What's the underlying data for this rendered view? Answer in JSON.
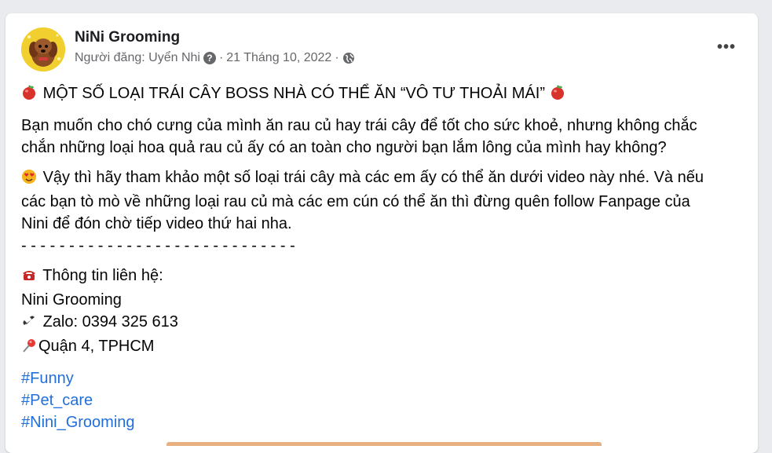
{
  "post": {
    "page_name": "NiNi Grooming",
    "author": "Người đăng: Uyển Nhi",
    "date": "21 Tháng 10, 2022",
    "separator": "·",
    "more_label": "•••",
    "title": "MỘT SỐ LOẠI TRÁI CÂY BOSS NHÀ CÓ THỂ ĂN “VÔ TƯ THOẢI MÁI”",
    "para1_line1": "Bạn muốn cho chó cưng của mình ăn rau củ hay trái cây để tốt cho sức khoẻ, nhưng không chắc",
    "para1_line2": "chắn những loại hoa quả rau củ ấy có an toàn cho người bạn lắm lông của mình hay không?",
    "para2_line1": "Vậy thì hãy tham khảo một số loại trái cây mà các em ấy có thể ăn dưới video này nhé. Và nếu",
    "para2_line2": "các bạn tò mò về những loại rau củ mà các em cún có thể ăn thì đừng quên follow Fanpage của",
    "para2_line3": "Nini để đón chờ tiếp video thứ hai nha.",
    "divider": "- - - - - - - - - - - - - - - - - - - - - - - - - - - - -",
    "contact_heading": "Thông tin liên hệ:",
    "contact_name": "Nini Grooming",
    "contact_phone": "Zalo: 0394 325 613",
    "contact_address": "Quận 4, TPHCM",
    "hashtags": [
      "#Funny",
      "#Pet_care",
      "#Nini_Grooming"
    ]
  },
  "icons": {
    "title_emoji": "apple-icon",
    "para2_emoji": "heart-eyes-icon",
    "contact_emoji": "telephone-icon",
    "phone_emoji": "phone-receiver-icon",
    "pin_emoji": "pushpin-icon",
    "privacy": "globe-icon",
    "author_info": "question-icon"
  },
  "colors": {
    "hashtag": "#216fdb",
    "meta_text": "#65676b",
    "avatar_bg": "#f1cf2e"
  }
}
